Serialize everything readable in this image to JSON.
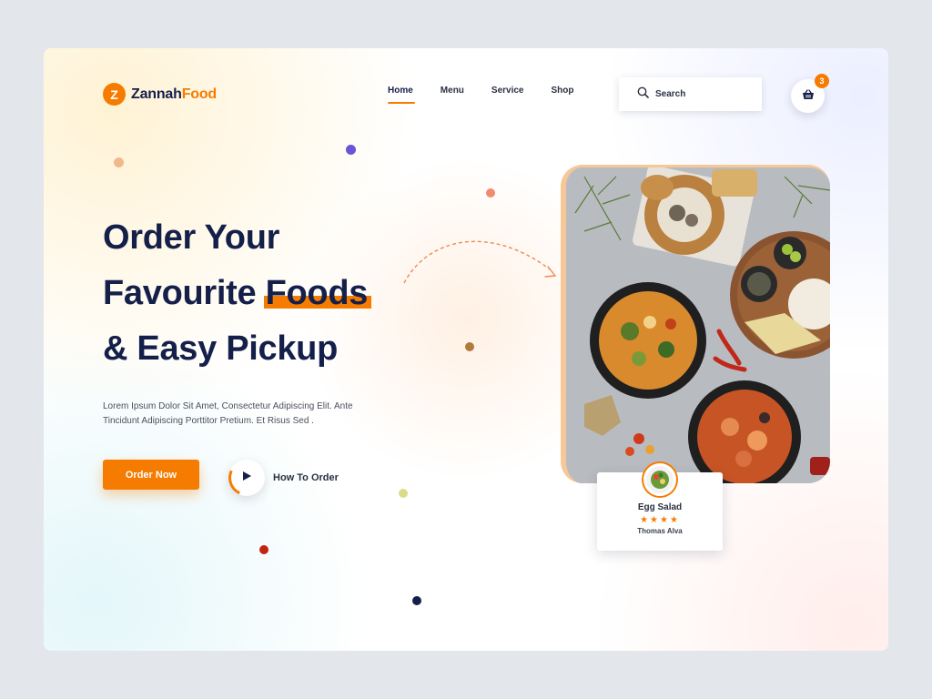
{
  "header": {
    "logo": {
      "badge": "Z",
      "name_part1": "Zannah",
      "name_part2": "Food"
    },
    "nav": [
      {
        "label": "Home",
        "active": true
      },
      {
        "label": "Menu",
        "active": false
      },
      {
        "label": "Service",
        "active": false
      },
      {
        "label": "Shop",
        "active": false
      }
    ],
    "search": {
      "placeholder": "Search",
      "icon": "search-icon"
    },
    "cart": {
      "icon": "basket-icon",
      "count": "3"
    }
  },
  "hero": {
    "line1": "Order Your",
    "line2_prefix": "Favourite ",
    "line2_highlight": "Foods",
    "line3": "& Easy Pickup",
    "description": "Lorem Ipsum Dolor Sit Amet, Consectetur Adipiscing Elit. Ante Tincidunt Adipiscing Porttitor Pretium. Et Risus Sed .",
    "order_button": "Order Now",
    "how_to_label": "How To Order",
    "play_icon": "play-icon"
  },
  "review": {
    "dish": "Egg Salad",
    "stars": "★★★★",
    "rating": 4,
    "author": "Thomas Alva"
  },
  "colors": {
    "accent": "#f57c00",
    "navy": "#15204a",
    "background": "#e3e6eb"
  }
}
